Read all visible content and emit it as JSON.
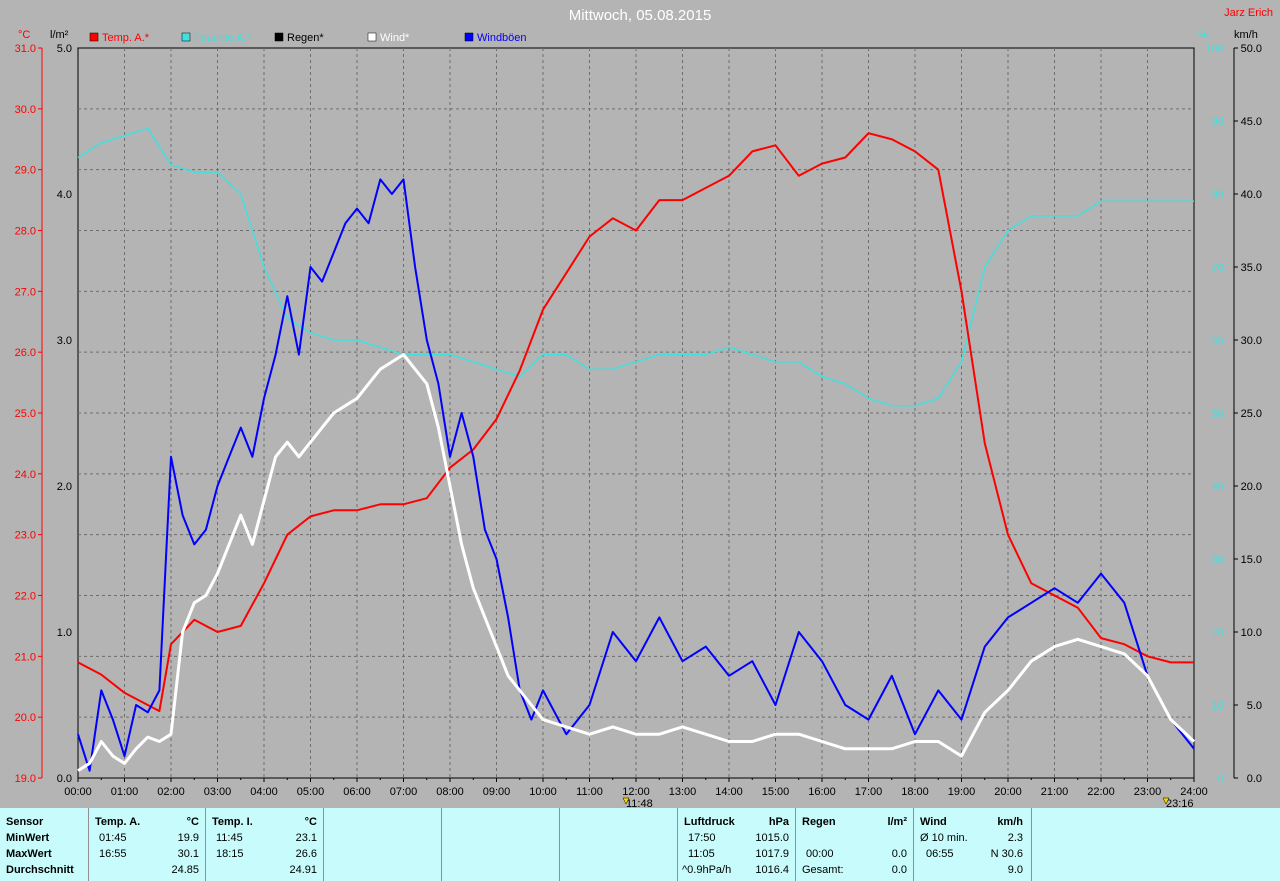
{
  "title": "Mittwoch, 05.08.2015",
  "author": "Jarz Erich",
  "unit_labels": {
    "temp": "°C",
    "rain": "l/m²",
    "humidity": "%",
    "wind": "km/h"
  },
  "legend": [
    {
      "label": "Temp. A.*",
      "color": "#ff0000"
    },
    {
      "label": "Feuchte A.*",
      "color": "#40e0e0"
    },
    {
      "label": "Regen*",
      "color": "#000000"
    },
    {
      "label": "Wind*",
      "color": "#ffffff"
    },
    {
      "label": "Windböen",
      "color": "#0000ff"
    }
  ],
  "markers": {
    "sunrise_label": "11:48",
    "sunset_label": "23:16"
  },
  "chart_data": {
    "type": "line",
    "title": "Mittwoch, 05.08.2015",
    "grid": true,
    "x_ticks": [
      "00:00",
      "01:00",
      "02:00",
      "03:00",
      "04:00",
      "05:00",
      "06:00",
      "07:00",
      "08:00",
      "09:00",
      "10:00",
      "11:00",
      "12:00",
      "13:00",
      "14:00",
      "15:00",
      "16:00",
      "17:00",
      "18:00",
      "19:00",
      "20:00",
      "21:00",
      "22:00",
      "23:00",
      "24:00"
    ],
    "axes": {
      "temp": {
        "range": [
          19.0,
          31.0
        ],
        "ticks": [
          "19.0",
          "20.0",
          "21.0",
          "22.0",
          "23.0",
          "24.0",
          "25.0",
          "26.0",
          "27.0",
          "28.0",
          "29.0",
          "30.0",
          "31.0"
        ]
      },
      "rain": {
        "range": [
          0,
          5
        ],
        "ticks": [
          "0.0",
          "1.0",
          "2.0",
          "3.0",
          "4.0",
          "5.0"
        ]
      },
      "humidity": {
        "range": [
          0,
          100
        ],
        "ticks": [
          "0",
          "10",
          "20",
          "30",
          "40",
          "50",
          "60",
          "70",
          "80",
          "90",
          "100"
        ]
      },
      "wind": {
        "range": [
          0,
          50
        ],
        "ticks": [
          "0.0",
          "5.0",
          "10.0",
          "15.0",
          "20.0",
          "25.0",
          "30.0",
          "35.0",
          "40.0",
          "45.0",
          "50.0"
        ]
      }
    },
    "series": [
      {
        "name": "Temp. A.*",
        "axis": "temp",
        "color": "#ff0000",
        "x": [
          0,
          0.5,
          1,
          1.5,
          1.75,
          2,
          2.5,
          3,
          3.5,
          4,
          4.5,
          5,
          5.5,
          6,
          6.5,
          7,
          7.5,
          8,
          8.5,
          9,
          9.5,
          10,
          10.5,
          11,
          11.5,
          12,
          12.5,
          13,
          13.5,
          14,
          14.5,
          15,
          15.5,
          16,
          16.5,
          17,
          17.5,
          18,
          18.5,
          19,
          19.5,
          20,
          20.5,
          21,
          21.5,
          22,
          22.5,
          23,
          23.5,
          24
        ],
        "y": [
          20.9,
          20.7,
          20.4,
          20.2,
          20.1,
          21.2,
          21.6,
          21.4,
          21.5,
          22.2,
          23.0,
          23.3,
          23.4,
          23.4,
          23.5,
          23.5,
          23.6,
          24.1,
          24.4,
          24.9,
          25.7,
          26.7,
          27.3,
          27.9,
          28.2,
          28.0,
          28.5,
          28.5,
          28.7,
          28.9,
          29.3,
          29.4,
          28.9,
          29.1,
          29.2,
          29.6,
          29.5,
          29.3,
          29.0,
          27.0,
          24.5,
          23.0,
          22.2,
          22.0,
          21.8,
          21.3,
          21.2,
          21.0,
          20.9,
          20.9
        ]
      },
      {
        "name": "Feuchte A.*",
        "axis": "humidity",
        "color": "#40e0e0",
        "x": [
          0,
          0.5,
          1,
          1.5,
          2,
          2.5,
          3,
          3.5,
          4,
          4.5,
          5,
          5.5,
          6,
          6.5,
          7,
          7.5,
          8,
          8.5,
          9,
          9.5,
          10,
          10.5,
          11,
          11.5,
          12,
          12.5,
          13,
          13.5,
          14,
          14.5,
          15,
          15.5,
          16,
          16.5,
          17,
          17.5,
          18,
          18.5,
          19,
          19.5,
          20,
          20.5,
          21,
          21.5,
          22,
          22.5,
          23,
          23.5,
          24
        ],
        "y": [
          85,
          87,
          88,
          89,
          84,
          83,
          83,
          80,
          70,
          63,
          61,
          60,
          60,
          59,
          58,
          58,
          58,
          57,
          56,
          55,
          58,
          58,
          56,
          56,
          57,
          58,
          58,
          58,
          59,
          58,
          57,
          57,
          55,
          54,
          52,
          51,
          51,
          52,
          57,
          70,
          75,
          77,
          77,
          77,
          79,
          79,
          79,
          79,
          79
        ]
      },
      {
        "name": "Wind*",
        "axis": "wind",
        "color": "#ffffff",
        "x": [
          0,
          0.25,
          0.5,
          0.75,
          1,
          1.25,
          1.5,
          1.75,
          2,
          2.25,
          2.5,
          2.75,
          3,
          3.25,
          3.5,
          3.75,
          4,
          4.25,
          4.5,
          4.75,
          5,
          5.25,
          5.5,
          5.75,
          6,
          6.25,
          6.5,
          6.75,
          7,
          7.25,
          7.5,
          7.75,
          8,
          8.25,
          8.5,
          8.75,
          9,
          9.25,
          9.5,
          9.75,
          10,
          10.5,
          11,
          11.5,
          12,
          12.5,
          13,
          13.5,
          14,
          14.5,
          15,
          15.5,
          16,
          16.5,
          17,
          17.5,
          18,
          18.5,
          19,
          19.5,
          20,
          20.5,
          21,
          21.5,
          22,
          22.5,
          23,
          23.5,
          24
        ],
        "y": [
          0.5,
          1,
          2.5,
          1.5,
          1,
          2,
          2.8,
          2.5,
          3,
          10,
          12,
          12.5,
          14,
          16,
          18,
          16,
          19,
          22,
          23,
          22,
          23,
          24,
          25,
          25.5,
          26,
          27,
          28,
          28.5,
          29,
          28,
          27,
          24,
          20,
          16,
          13,
          11,
          9,
          7,
          6,
          5,
          4,
          3.5,
          3,
          3.5,
          3,
          3,
          3.5,
          3,
          2.5,
          2.5,
          3,
          3,
          2.5,
          2,
          2,
          2,
          2.5,
          2.5,
          1.5,
          4.5,
          6,
          8,
          9,
          9.5,
          9,
          8.5,
          7,
          4,
          2.5
        ]
      },
      {
        "name": "Windböen",
        "axis": "wind",
        "color": "#0000ff",
        "x": [
          0,
          0.25,
          0.5,
          0.75,
          1,
          1.25,
          1.5,
          1.75,
          2,
          2.25,
          2.5,
          2.75,
          3,
          3.25,
          3.5,
          3.75,
          4,
          4.25,
          4.5,
          4.75,
          5,
          5.25,
          5.5,
          5.75,
          6,
          6.25,
          6.5,
          6.75,
          7,
          7.25,
          7.5,
          7.75,
          8,
          8.25,
          8.5,
          8.75,
          9,
          9.25,
          9.5,
          9.75,
          10,
          10.5,
          11,
          11.5,
          12,
          12.5,
          13,
          13.5,
          14,
          14.5,
          15,
          15.5,
          16,
          16.5,
          17,
          17.5,
          18,
          18.5,
          19,
          19.5,
          20,
          20.5,
          21,
          21.5,
          22,
          22.5,
          23,
          23.5,
          24
        ],
        "y": [
          3,
          0.5,
          6,
          4,
          1.5,
          5,
          4.5,
          6,
          22,
          18,
          16,
          17,
          20,
          22,
          24,
          22,
          26,
          29,
          33,
          29,
          35,
          34,
          36,
          38,
          39,
          38,
          41,
          40,
          41,
          35,
          30,
          27,
          22,
          25,
          22,
          17,
          15,
          11,
          6,
          4,
          6,
          3,
          5,
          10,
          8,
          11,
          8,
          9,
          7,
          8,
          5,
          10,
          8,
          5,
          4,
          7,
          3,
          6,
          4,
          9,
          11,
          12,
          13,
          12,
          14,
          12,
          7,
          4,
          2
        ]
      }
    ]
  },
  "stats": {
    "sensor_header": "Sensor",
    "row_labels": [
      "MinWert",
      "MaxWert",
      "Durchschnitt"
    ],
    "temp_a": {
      "header": "Temp. A.",
      "unit": "°C",
      "min_time": "01:45",
      "min": "19.9",
      "max_time": "16:55",
      "max": "30.1",
      "avg": "24.85"
    },
    "temp_i": {
      "header": "Temp. I.",
      "unit": "°C",
      "min_time": "11:45",
      "min": "23.1",
      "max_time": "18:15",
      "max": "26.6",
      "avg": "24.91"
    },
    "pressure": {
      "header": "Luftdruck",
      "unit": "hPa",
      "min_time": "17:50",
      "min": "1015.0",
      "max_time": "11:05",
      "max": "1017.9",
      "trend": "^0.9hPa/h",
      "avg": "1016.4"
    },
    "rain": {
      "header": "Regen",
      "unit": "l/m²",
      "max_time": "00:00",
      "max": "0.0",
      "total_label": "Gesamt:",
      "total": "0.0"
    },
    "wind": {
      "header": "Wind",
      "unit": "km/h",
      "avg10_label": "Ø 10 min.",
      "avg10": "2.3",
      "max_time": "06:55",
      "max": "N 30.6",
      "avg": "9.0"
    }
  }
}
